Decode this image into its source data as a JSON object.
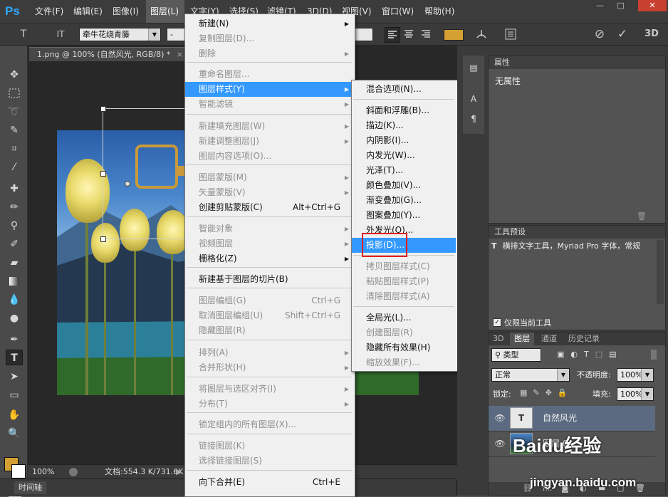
{
  "app": {
    "logo": "Ps"
  },
  "menubar": {
    "items": [
      "文件(F)",
      "编辑(E)",
      "图像(I)",
      "图层(L)",
      "文字(Y)",
      "选择(S)",
      "滤镜(T)",
      "3D(D)",
      "视图(V)",
      "窗口(W)",
      "帮助(H)"
    ],
    "window_buttons": [
      "—",
      "□",
      "✕"
    ]
  },
  "options_bar": {
    "tool_icon": "T",
    "orient_icon": "IT",
    "font_family": "牵牛花绕青籐",
    "font_style_placeholder": "-",
    "align_icons": [
      "align-left-icon",
      "align-center-icon",
      "align-right-icon"
    ],
    "text_color": "#d4a033",
    "cancel_icon": "⊘",
    "commit_icon": "✓",
    "three_d_label": "3D"
  },
  "document": {
    "tab_title": "1.png @ 100% (自然风光, RGB/8) *",
    "zoom": "100%",
    "doc_info": "文档:554.3 K/731.6K",
    "timeline_label": "时间轴"
  },
  "layer_menu": {
    "items": [
      {
        "label": "新建(N)",
        "shortcut": "",
        "submenu": true,
        "disabled": false
      },
      {
        "label": "复制图层(D)...",
        "shortcut": "",
        "submenu": false,
        "disabled": true
      },
      {
        "label": "删除",
        "shortcut": "",
        "submenu": true,
        "disabled": true
      },
      {
        "label": "重命名图层...",
        "shortcut": "",
        "submenu": false,
        "disabled": true
      },
      {
        "label": "图层样式(Y)",
        "shortcut": "",
        "submenu": true,
        "disabled": false,
        "highlighted": true
      },
      {
        "label": "智能滤镜",
        "shortcut": "",
        "submenu": true,
        "disabled": true
      },
      {
        "label": "新建填充图层(W)",
        "shortcut": "",
        "submenu": true,
        "disabled": true
      },
      {
        "label": "新建调整图层(J)",
        "shortcut": "",
        "submenu": true,
        "disabled": true
      },
      {
        "label": "图层内容选项(O)...",
        "shortcut": "",
        "submenu": false,
        "disabled": true
      },
      {
        "label": "图层蒙版(M)",
        "shortcut": "",
        "submenu": true,
        "disabled": true
      },
      {
        "label": "矢量蒙版(V)",
        "shortcut": "",
        "submenu": true,
        "disabled": true
      },
      {
        "label": "创建剪贴蒙版(C)",
        "shortcut": "Alt+Ctrl+G",
        "submenu": false,
        "disabled": false
      },
      {
        "label": "智能对象",
        "shortcut": "",
        "submenu": true,
        "disabled": true
      },
      {
        "label": "视频图层",
        "shortcut": "",
        "submenu": true,
        "disabled": true
      },
      {
        "label": "栅格化(Z)",
        "shortcut": "",
        "submenu": true,
        "disabled": false
      },
      {
        "label": "新建基于图层的切片(B)",
        "shortcut": "",
        "submenu": false,
        "disabled": false
      },
      {
        "label": "图层编组(G)",
        "shortcut": "Ctrl+G",
        "submenu": false,
        "disabled": true
      },
      {
        "label": "取消图层编组(U)",
        "shortcut": "Shift+Ctrl+G",
        "submenu": false,
        "disabled": true
      },
      {
        "label": "隐藏图层(R)",
        "shortcut": "",
        "submenu": false,
        "disabled": true
      },
      {
        "label": "排列(A)",
        "shortcut": "",
        "submenu": true,
        "disabled": true
      },
      {
        "label": "合并形状(H)",
        "shortcut": "",
        "submenu": true,
        "disabled": true
      },
      {
        "label": "将图层与选区对齐(I)",
        "shortcut": "",
        "submenu": true,
        "disabled": true
      },
      {
        "label": "分布(T)",
        "shortcut": "",
        "submenu": true,
        "disabled": true
      },
      {
        "label": "锁定组内的所有图层(X)...",
        "shortcut": "",
        "submenu": false,
        "disabled": true
      },
      {
        "label": "链接图层(K)",
        "shortcut": "",
        "submenu": false,
        "disabled": true
      },
      {
        "label": "选择链接图层(S)",
        "shortcut": "",
        "submenu": false,
        "disabled": true
      },
      {
        "label": "向下合并(E)",
        "shortcut": "Ctrl+E",
        "submenu": false,
        "disabled": false
      }
    ]
  },
  "style_submenu": {
    "items": [
      {
        "label": "混合选项(N)...",
        "disabled": false
      },
      {
        "label": "斜面和浮雕(B)...",
        "disabled": false
      },
      {
        "label": "描边(K)...",
        "disabled": false
      },
      {
        "label": "内阴影(I)...",
        "disabled": false
      },
      {
        "label": "内发光(W)...",
        "disabled": false
      },
      {
        "label": "光泽(T)...",
        "disabled": false
      },
      {
        "label": "颜色叠加(V)...",
        "disabled": false
      },
      {
        "label": "渐变叠加(G)...",
        "disabled": false
      },
      {
        "label": "图案叠加(Y)...",
        "disabled": false
      },
      {
        "label": "外发光(O)...",
        "disabled": false
      },
      {
        "label": "投影(D)...",
        "disabled": false,
        "highlighted": true
      },
      {
        "label": "拷贝图层样式(C)",
        "disabled": true
      },
      {
        "label": "粘贴图层样式(P)",
        "disabled": true
      },
      {
        "label": "清除图层样式(A)",
        "disabled": true
      },
      {
        "label": "全局光(L)...",
        "disabled": false
      },
      {
        "label": "创建图层(R)",
        "disabled": true
      },
      {
        "label": "隐藏所有效果(H)",
        "disabled": false
      },
      {
        "label": "缩放效果(F)...",
        "disabled": true
      }
    ],
    "highlight_box_color": "#e02020"
  },
  "properties_panel": {
    "title": "属性",
    "body": "无属性"
  },
  "tool_presets_panel": {
    "title": "工具预设",
    "item": "横排文字工具，Myriad Pro 字体，常规",
    "checkbox_label": "仅限当前工具",
    "checkbox_checked": true
  },
  "layers_panel": {
    "tabs": [
      "3D",
      "图层",
      "通道",
      "历史记录"
    ],
    "active_tab": "图层",
    "filter_kind": "类型",
    "blend_mode": "正常",
    "opacity_label": "不透明度:",
    "opacity": "100%",
    "lock_label": "锁定:",
    "fill_label": "填充:",
    "fill": "100%",
    "layers": [
      {
        "name": "自然风光",
        "type": "text",
        "selected": true,
        "visible": true
      },
      {
        "name": "图层 0",
        "type": "image",
        "selected": false,
        "visible": true
      }
    ],
    "footer_icons": [
      "link-icon",
      "fx-icon",
      "mask-icon",
      "adjustment-icon",
      "folder-icon",
      "new-layer-icon",
      "trash-icon"
    ],
    "fx_label": "fx."
  },
  "watermark": {
    "brand": "Baidu经验",
    "url": "jingyan.baidu.com"
  }
}
